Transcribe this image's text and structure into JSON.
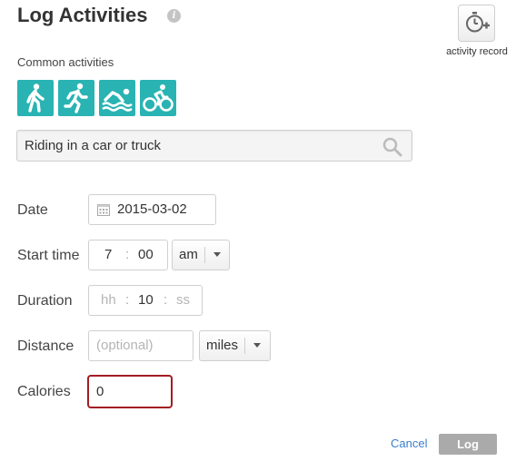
{
  "header": {
    "title": "Log Activities",
    "info_icon": "info-icon",
    "record_label": "activity record",
    "record_icon": "stopwatch-plus-icon"
  },
  "common": {
    "label": "Common activities",
    "activities": [
      {
        "icon": "walking-icon"
      },
      {
        "icon": "running-icon"
      },
      {
        "icon": "swimming-icon"
      },
      {
        "icon": "cycling-icon"
      }
    ],
    "accent_color": "#2ab3b3"
  },
  "search": {
    "value": "Riding in a car or truck",
    "icon": "search-icon"
  },
  "form": {
    "date": {
      "label": "Date",
      "value": "2015-03-02",
      "icon": "calendar-icon"
    },
    "start_time": {
      "label": "Start time",
      "hour": "7",
      "minute": "00",
      "separator": ":",
      "ampm": "am"
    },
    "duration": {
      "label": "Duration",
      "hours_placeholder": "hh",
      "minutes": "10",
      "seconds_placeholder": "ss",
      "separator": ":"
    },
    "distance": {
      "label": "Distance",
      "placeholder": "(optional)",
      "unit": "miles"
    },
    "calories": {
      "label": "Calories",
      "value": "0",
      "error_color": "#a31c22"
    }
  },
  "actions": {
    "cancel": "Cancel",
    "log": "Log"
  }
}
